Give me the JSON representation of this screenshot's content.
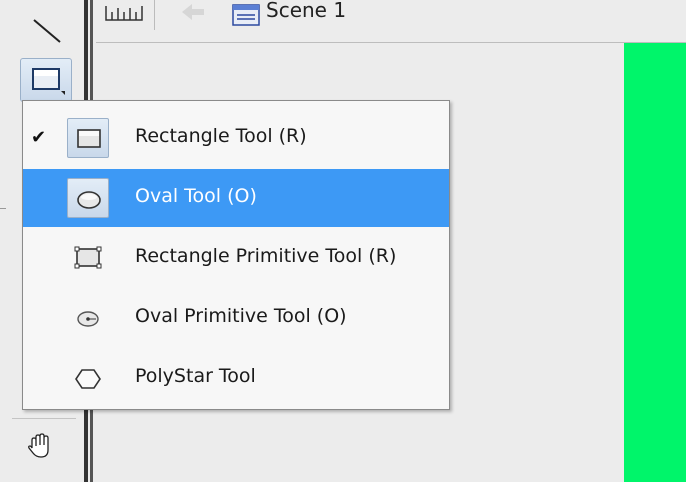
{
  "topbar": {
    "scene_label": "Scene 1"
  },
  "menu": {
    "items": [
      {
        "label": "Rectangle Tool (R)",
        "checked": true,
        "icon": "rectangle-icon"
      },
      {
        "label": "Oval Tool (O)",
        "selected": true,
        "icon": "oval-icon"
      },
      {
        "label": "Rectangle Primitive Tool (R)",
        "icon": "rectangle-primitive-icon"
      },
      {
        "label": "Oval Primitive Tool (O)",
        "icon": "oval-primitive-icon"
      },
      {
        "label": "PolyStar Tool",
        "icon": "polystar-icon"
      }
    ],
    "check_glyph": "✔"
  },
  "colors": {
    "selection": "#3d99f5",
    "stage": "#00f56a"
  }
}
